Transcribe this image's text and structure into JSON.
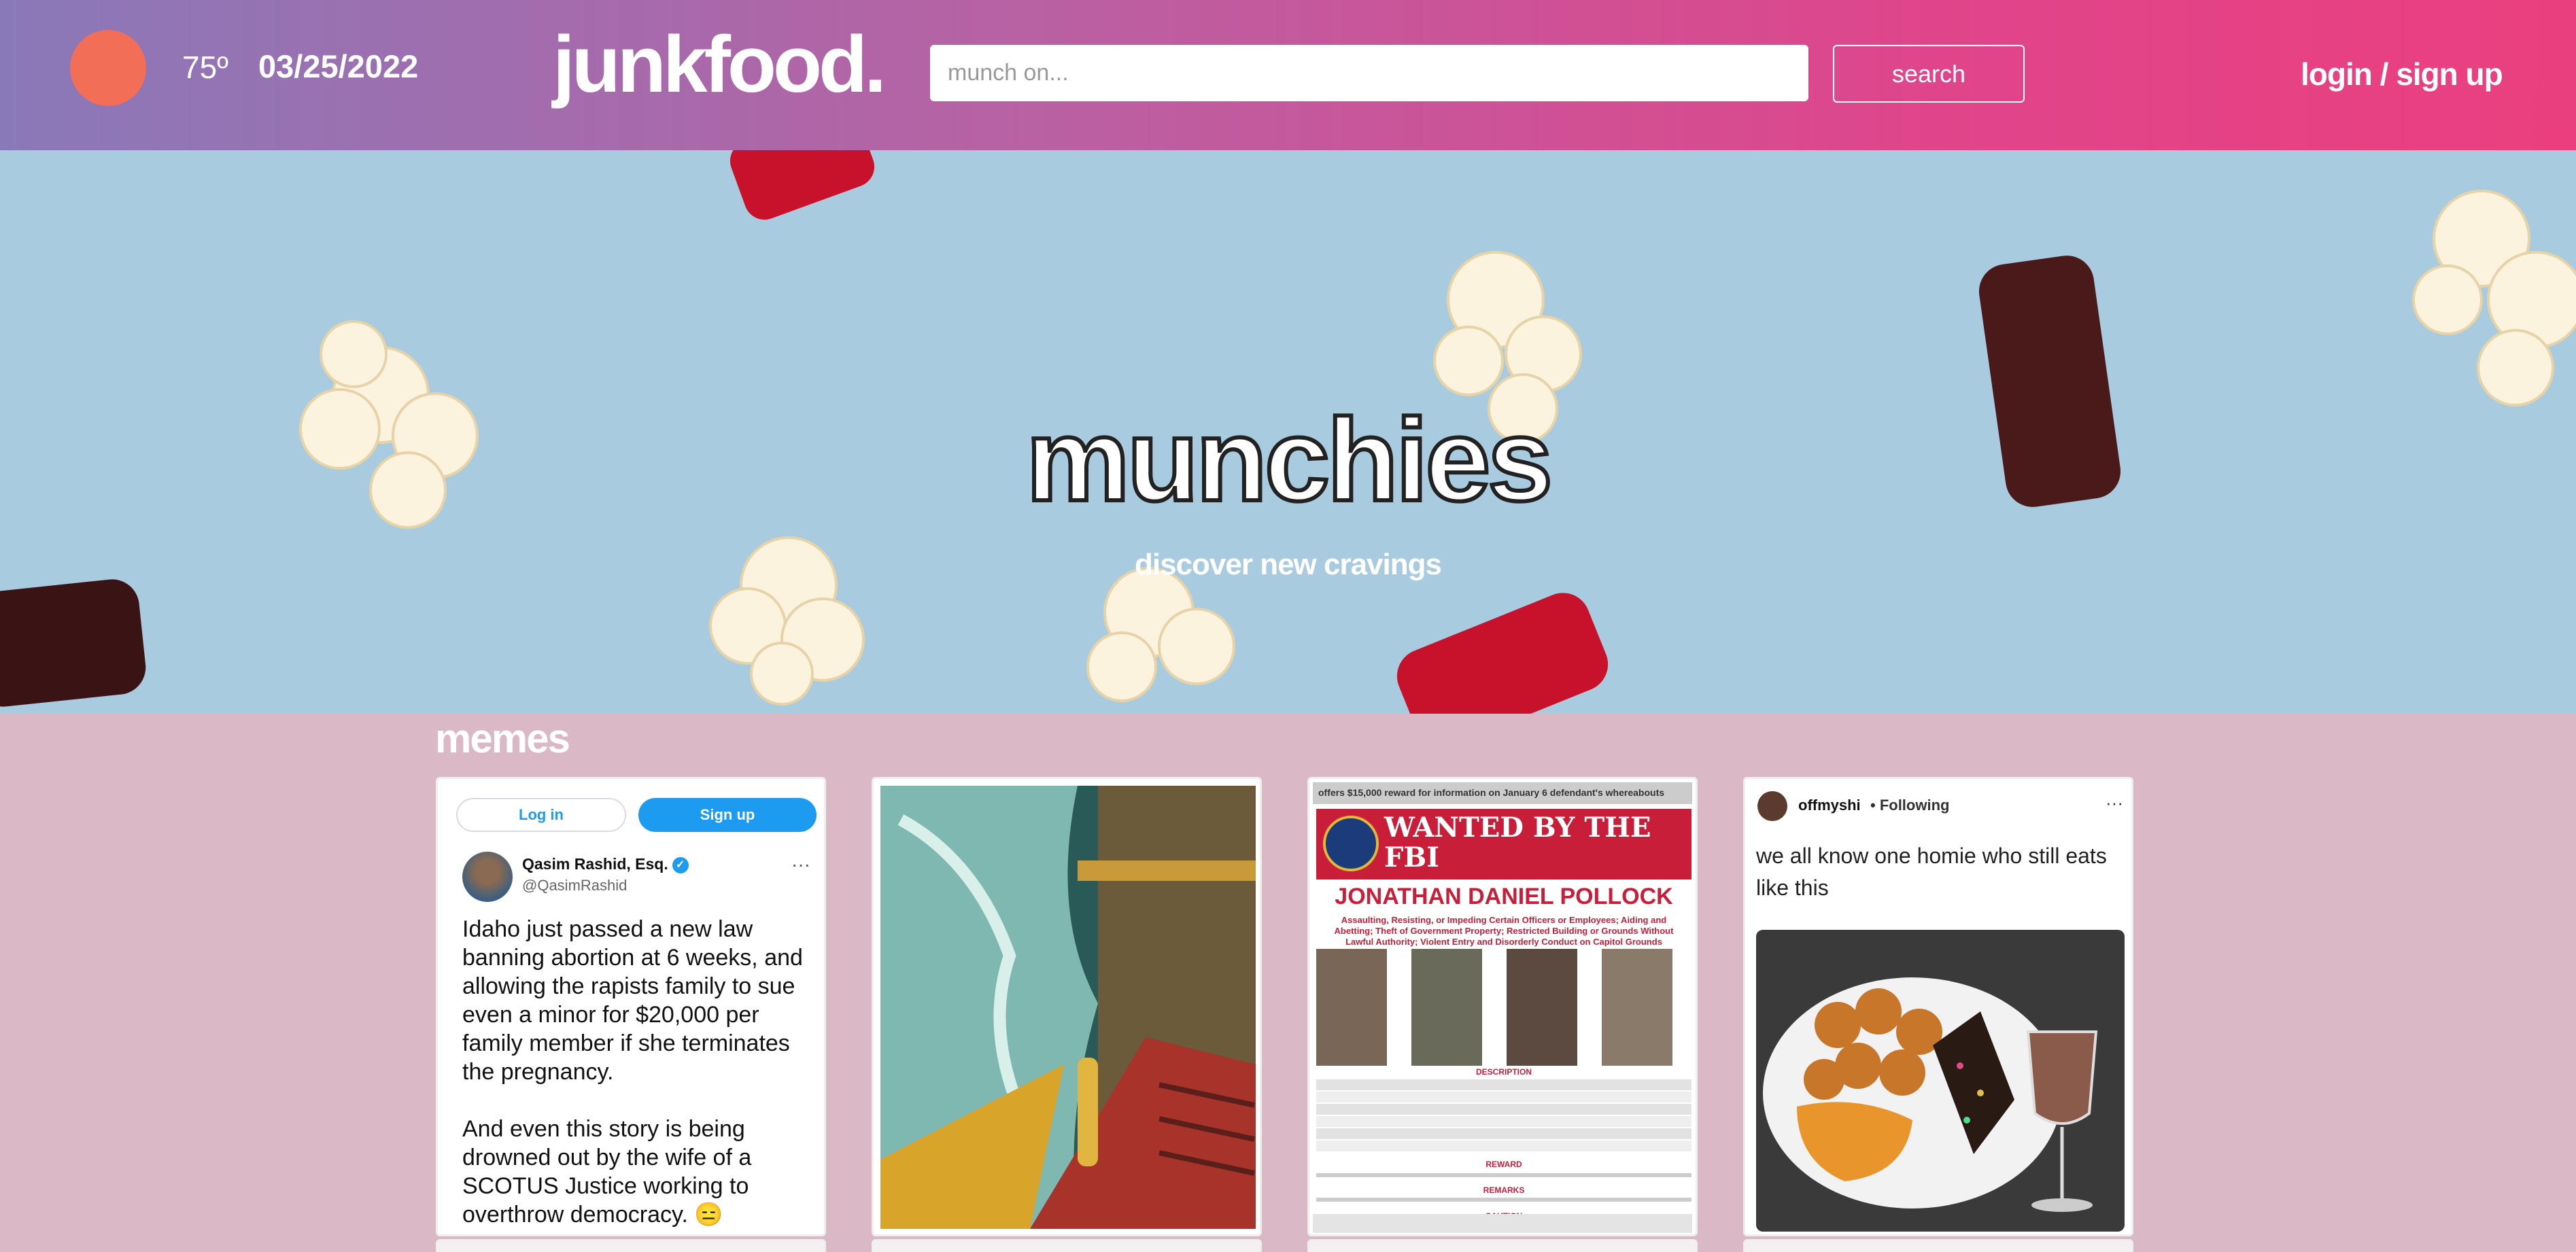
{
  "header": {
    "temperature": "75º",
    "date": "03/25/2022",
    "logo": "junkfood.",
    "search_placeholder": "munch on...",
    "search_button": "search",
    "login_link": "login / sign up"
  },
  "hero": {
    "title": "munchies",
    "subtitle": "discover new cravings"
  },
  "memes": {
    "heading": "memes",
    "tweet": {
      "login_button": "Log in",
      "signup_button": "Sign up",
      "name": "Qasim Rashid, Esq.",
      "handle": "@QasimRashid",
      "text": "Idaho just passed a new law banning abortion at 6 weeks, and allowing the rapists family to sue even a minor for $20,000 per family member if she terminates the pregnancy.\n\nAnd even this story is being drowned out by the wife of a SCOTUS Justice working to overthrow democracy. 😑"
    },
    "fbi": {
      "top_bar": "offers $15,000 reward for information on January 6 defendant's whereabouts",
      "banner": "WANTED BY THE FBI",
      "name": "JONATHAN DANIEL POLLOCK",
      "charges": "Assaulting, Resisting, or Impeding Certain Officers or Employees; Aiding and Abetting; Theft of Government Property; Restricted Building or Grounds Without Lawful Authority; Violent Entry and Disorderly Conduct on Capitol Grounds",
      "description_heading": "DESCRIPTION",
      "reward_heading": "REWARD",
      "remarks_heading": "REMARKS",
      "caution_heading": "CAUTION"
    },
    "instagram": {
      "username": "offmyshi",
      "following": "• Following",
      "caption": "we all know one homie who still eats like this"
    }
  },
  "colors": {
    "header_gradient_start": "#8a79b8",
    "header_gradient_end": "#ea3f7e",
    "weather_dot": "#f26e57",
    "page_background": "#dbb8c6",
    "hero_background": "#a9cbe0",
    "twitter_blue": "#1d9bf0",
    "fbi_red": "#c91e3a"
  }
}
